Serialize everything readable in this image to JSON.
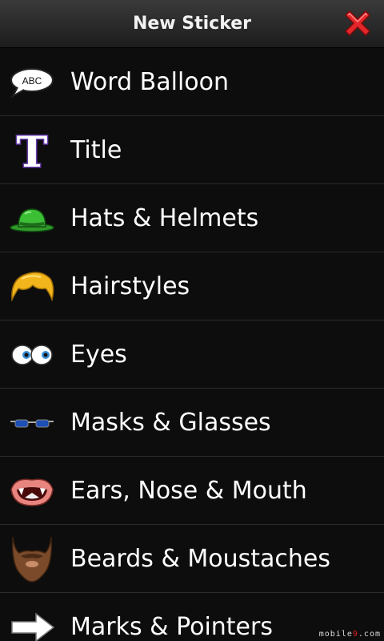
{
  "header": {
    "title": "New Sticker",
    "close_icon": "close-icon",
    "close_color": "#e3262a"
  },
  "items": [
    {
      "label": "Word Balloon",
      "icon": "word-balloon-icon",
      "icon_text": "ABC"
    },
    {
      "label": "Title",
      "icon": "title-t-icon",
      "icon_text": "T"
    },
    {
      "label": "Hats & Helmets",
      "icon": "hat-icon"
    },
    {
      "label": "Hairstyles",
      "icon": "hair-icon"
    },
    {
      "label": "Eyes",
      "icon": "eyes-icon"
    },
    {
      "label": "Masks & Glasses",
      "icon": "glasses-icon"
    },
    {
      "label": "Ears, Nose & Mouth",
      "icon": "mouth-icon"
    },
    {
      "label": "Beards & Moustaches",
      "icon": "beard-icon"
    },
    {
      "label": "Marks & Pointers",
      "icon": "arrow-pointer-icon"
    }
  ],
  "watermark": {
    "left": "mobile",
    "mid": "9",
    "right": ".com"
  }
}
